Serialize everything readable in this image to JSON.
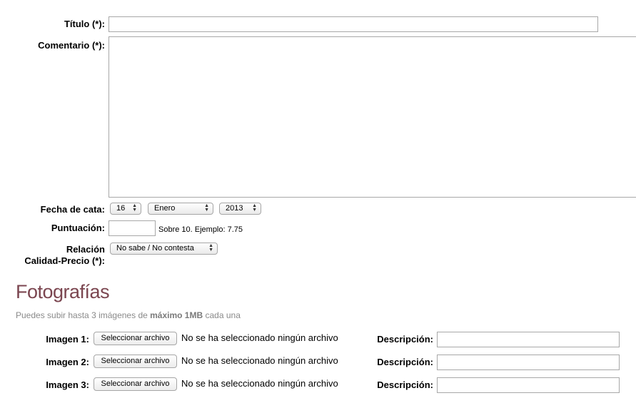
{
  "form": {
    "titulo_label": "Título (*):",
    "titulo_value": "",
    "comentario_label": "Comentario (*):",
    "comentario_value": "",
    "fecha_label": "Fecha de cata:",
    "fecha_dia": "16",
    "fecha_mes": "Enero",
    "fecha_anio": "2013",
    "puntuacion_label": "Puntuación:",
    "puntuacion_value": "",
    "puntuacion_hint": "Sobre 10. Ejemplo: 7.75",
    "relacion_label_1": "Relación",
    "relacion_label_2": "Calidad-Precio (*):",
    "relacion_value": "No sabe / No contesta"
  },
  "fotos": {
    "title": "Fotografías",
    "note_prefix": "Puedes subir hasta 3 imágenes de ",
    "note_bold": "máximo 1MB",
    "note_suffix": " cada una",
    "images": [
      {
        "label": "Imagen 1:",
        "button": "Seleccionar archivo",
        "status": "No se ha seleccionado ningún archivo",
        "desc_label": "Descripción:",
        "desc_value": ""
      },
      {
        "label": "Imagen 2:",
        "button": "Seleccionar archivo",
        "status": "No se ha seleccionado ningún archivo",
        "desc_label": "Descripción:",
        "desc_value": ""
      },
      {
        "label": "Imagen 3:",
        "button": "Seleccionar archivo",
        "status": "No se ha seleccionado ningún archivo",
        "desc_label": "Descripción:",
        "desc_value": ""
      }
    ]
  },
  "colors": {
    "section_title": "#7b4650",
    "note_text": "#8a8a8a",
    "field_border": "#a8a8a8"
  }
}
